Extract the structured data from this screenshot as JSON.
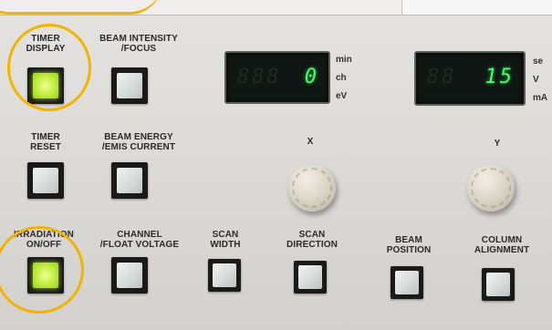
{
  "buttons": {
    "timer_display": "TIMER\nDISPLAY",
    "beam_intensity": "BEAM  INTENSITY\n/FOCUS",
    "timer_reset": "TIMER\nRESET",
    "beam_energy": "BEAM  ENERGY\n/EMIS  CURRENT",
    "irradiation": "IRRADIATION\nON/OFF",
    "channel": "CHANNEL\n/FLOAT  VOLTAGE",
    "scan_width": "SCAN\nWIDTH",
    "scan_direction": "SCAN\nDIRECTION",
    "beam_position": "BEAM\nPOSITION",
    "column_alignment": "COLUMN\nALIGNMENT"
  },
  "display_left": {
    "value": "0",
    "units": [
      "min",
      "ch",
      "eV"
    ]
  },
  "display_right": {
    "value": "15",
    "units": [
      "se",
      "V",
      "mA"
    ]
  },
  "knobs": {
    "x_label": "X",
    "y_label": "Y"
  },
  "colors": {
    "lit_button": "#b8ec3a",
    "highlight_circle": "#f3b400",
    "digit_green": "#3cff6a"
  }
}
